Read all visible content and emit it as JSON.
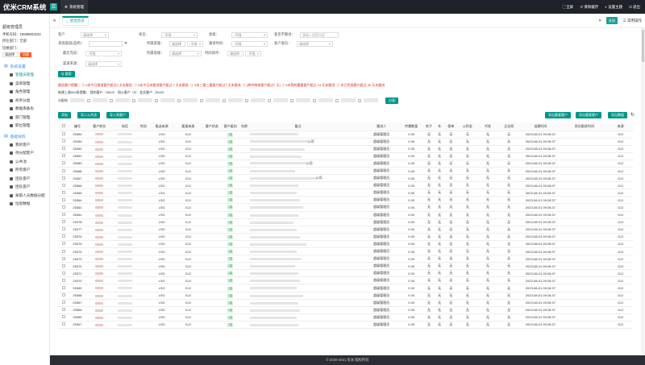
{
  "app": {
    "title": "优米CRM系统",
    "top_tab": "系统管理"
  },
  "top_right": [
    "全屏",
    "清除缓存",
    "设置主题",
    "退出"
  ],
  "tabs": {
    "home": "后台首页",
    "close": "关闭",
    "ops": "常用操作"
  },
  "user": {
    "name": "超级管理员",
    "phone_label": "手机号码：18588803232",
    "dept_label": "所在部门：全部",
    "dept_switch_label": "切换部门：",
    "dept_select": "请选择",
    "dept_btn": "切换"
  },
  "nav": {
    "group1": "系统设置",
    "group1_items": [
      "管理员管理",
      "菜单管理",
      "角色管理",
      "商务分类",
      "数据库备份",
      "部门管理",
      "职位管理"
    ],
    "group2": "基础资料",
    "group2_items": [
      "我的客户",
      "待分配客户",
      "公共池",
      "所有客户",
      "团队客户",
      "团队客户",
      "离职人员数据分配",
      "垃圾数据"
    ]
  },
  "filters": {
    "row1": [
      {
        "label": "客户",
        "value": "请选择"
      },
      {
        "label": "状态：",
        "value": "-不限-"
      },
      {
        "label": "星级：",
        "value": "-不限-"
      },
      {
        "label": "意见不跟进：",
        "value": "请输入搜索内容"
      }
    ],
    "row2": [
      {
        "label": "来源渠道(选择)：",
        "value": ""
      },
      {
        "label": "所属客服：",
        "value": "请选择",
        "extra": "-不限-"
      },
      {
        "label": "跟进时间：",
        "value": "-不限-"
      },
      {
        "label": "客户意向：",
        "value": "请选择"
      }
    ],
    "row3": [
      {
        "label": "最近完成：",
        "value": "-不限-"
      },
      {
        "label": "所属客服：",
        "value": "请选择"
      },
      {
        "label": "时间排序：",
        "value": "请选择",
        "extra": "-不限-"
      }
    ],
    "row4": [
      {
        "label": "渠道来源：",
        "value": "请选择"
      }
    ],
    "search_btn": "Q 搜索"
  },
  "stats": {
    "line1": "跟进客户提醒：  ① 5本今日跟进客户超过3  天未跟进:  ① 5本今日未跟进客户超过  7  天未跟进:  ① 5本三量三量客户超过7  天未跟进:  ① (跨中跨前客户超过7  天)  ① 5本我的重要客户超过  14  天未跟进:  ① 本已完成客户超过  30  天未跟进",
    "line2": "新建上限500条提醒：  我的客户（3529）  网公客户（5）  会员客户（3529）"
  },
  "distribute": {
    "label": "分配给",
    "btn": "分配"
  },
  "toolbar": {
    "add": "添加",
    "import_pool": "导入公共池",
    "import_my": "导入到客户",
    "export_important": "导出重要客户",
    "export_normal": "导出重要客户",
    "export_data": "导出数据"
  },
  "table": {
    "headers": [
      "",
      "编号",
      "客户姓名",
      "电话",
      "性别",
      "推送来源",
      "渠道来源",
      "客户状态",
      "客户级别",
      "年龄",
      "备注",
      "",
      "跟进人",
      "传播数量",
      "房子",
      "车",
      "保单",
      "公积金",
      "代发",
      "企业网",
      "创建时间",
      "再次跟进时间",
      "来源"
    ],
    "rows": [
      {
        "id": "25384",
        "src": "LSG",
        "ch": "GJJ",
        "lvl": "1星",
        "amount": "0.00",
        "time": "2023-08-01 09:28:37"
      },
      {
        "id": "25383",
        "src": "LSG",
        "ch": "GJJ",
        "lvl": "1星",
        "amount": "0.00",
        "time": "2023-08-01 09:28:37"
      },
      {
        "id": "25382",
        "src": "LSG",
        "ch": "GJJ",
        "lvl": "1星",
        "amount": "0.00",
        "time": "2023-08-01 09:28:37"
      },
      {
        "id": "25381",
        "src": "LSG",
        "ch": "GJJ",
        "lvl": "1星",
        "amount": "0.00",
        "time": "2023-08-01 09:28:37"
      },
      {
        "id": "25380",
        "src": "LSG",
        "ch": "GJJ",
        "lvl": "1星",
        "amount": "0.00",
        "time": "2023-08-01 09:28:37"
      },
      {
        "id": "25368",
        "src": "LSG",
        "ch": "GJJ",
        "lvl": "1星",
        "amount": "0.00",
        "time": "2023-08-01 09:28:37"
      },
      {
        "id": "25367",
        "src": "LSG",
        "ch": "GJJ",
        "lvl": "1星",
        "amount": "0.00",
        "time": "2023-08-01 09:28:37"
      },
      {
        "id": "25366",
        "src": "LSG",
        "ch": "GJJ",
        "lvl": "1星",
        "amount": "0.00",
        "time": "2023-08-01 09:28:37"
      },
      {
        "id": "25365",
        "src": "LSG",
        "ch": "GJJ",
        "lvl": "1星",
        "amount": "0.00",
        "time": "2023-08-01 09:28:37"
      },
      {
        "id": "25364",
        "src": "LSG",
        "ch": "GJJ",
        "lvl": "1星",
        "amount": "0.00",
        "time": "2023-08-01 09:28:37"
      },
      {
        "id": "25362",
        "src": "LSG",
        "ch": "GJJ",
        "lvl": "1星",
        "amount": "0.00",
        "time": "2023-08-01 09:28:37"
      },
      {
        "id": "25361",
        "src": "LSG",
        "ch": "GJJ",
        "lvl": "1星",
        "amount": "0.00",
        "time": "2023-08-01 09:28:37"
      },
      {
        "id": "25378",
        "src": "LSG",
        "ch": "GJJ",
        "lvl": "1星",
        "amount": "0.00",
        "time": "2023-08-01 09:28:37"
      },
      {
        "id": "25377",
        "src": "LSG",
        "ch": "GJJ",
        "lvl": "1星",
        "amount": "0.00",
        "time": "2023-08-01 09:28:37"
      },
      {
        "id": "25376",
        "src": "LSG",
        "ch": "GJJ",
        "lvl": "1星",
        "amount": "0.00",
        "time": "2023-08-01 09:28:37"
      },
      {
        "id": "25375",
        "src": "LSG",
        "ch": "GJJ",
        "lvl": "1星",
        "amount": "0.00",
        "time": "2023-08-01 09:28:37"
      },
      {
        "id": "25374",
        "src": "LSG",
        "ch": "GJJ",
        "lvl": "1星",
        "amount": "0.00",
        "time": "2023-08-01 09:28:37"
      },
      {
        "id": "25373",
        "src": "LSG",
        "ch": "GJJ",
        "lvl": "1星",
        "amount": "0.00",
        "time": "2023-08-01 09:28:37"
      },
      {
        "id": "25372",
        "src": "LSG",
        "ch": "GJJ",
        "lvl": "1星",
        "amount": "0.00",
        "time": "2023-08-01 09:28:37"
      },
      {
        "id": "25371",
        "src": "LSG",
        "ch": "GJJ",
        "lvl": "1星",
        "amount": "0.00",
        "time": "2023-08-01 09:28:37"
      },
      {
        "id": "25370",
        "src": "LSG",
        "ch": "GJJ",
        "lvl": "1星",
        "amount": "0.00",
        "time": "2023-08-01 09:28:37"
      },
      {
        "id": "25369",
        "src": "LSG",
        "ch": "GJJ",
        "lvl": "1星",
        "amount": "0.00",
        "time": "2023-08-01 09:28:37"
      },
      {
        "id": "25368",
        "src": "LSG",
        "ch": "GJJ",
        "lvl": "1星",
        "amount": "0.00",
        "time": "2023-08-01 09:28:37"
      },
      {
        "id": "25367",
        "src": "LSG",
        "ch": "GJJ",
        "lvl": "1星",
        "amount": "0.00",
        "time": "2023-08-01 09:28:37"
      },
      {
        "id": "25366",
        "src": "LSG",
        "ch": "GJJ",
        "lvl": "1星",
        "amount": "0.00",
        "time": "2023-08-01 09:28:37"
      },
      {
        "id": "25365",
        "src": "LSG",
        "ch": "GJJ",
        "lvl": "1星",
        "amount": "0.00",
        "time": "2023-08-01 09:28:37"
      },
      {
        "id": "25367",
        "src": "LSG",
        "ch": "GJJ",
        "lvl": "1星",
        "amount": "0.00",
        "time": "2023-08-01 09:28:37"
      }
    ],
    "follower": "超级管理员",
    "no": "无",
    "origin": "GJJ",
    "note_suffixes": [
      "",
      "公司",
      "",
      "",
      "公司",
      "",
      "公司",
      "",
      "",
      "",
      "",
      "",
      "",
      "",
      "",
      "",
      "",
      "",
      "",
      "",
      "",
      "",
      "",
      "",
      "",
      "",
      ""
    ]
  },
  "footer": "© 2020-2021 优米 版权所有",
  "colors": {
    "accent": "#009688",
    "topbar": "#1f2329",
    "danger": "#ff5722",
    "link": "#2e8ef0"
  }
}
